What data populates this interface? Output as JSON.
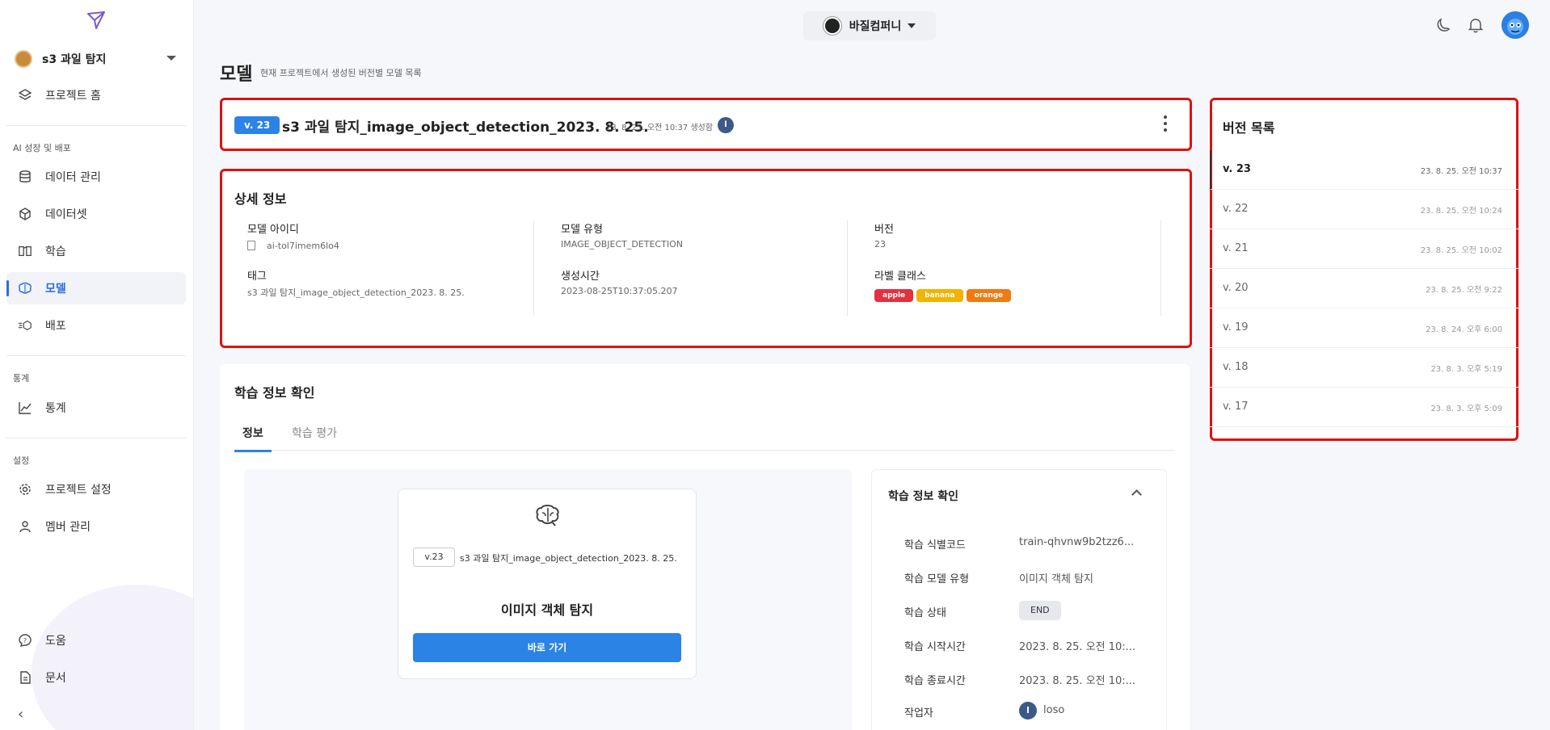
{
  "sidebar": {
    "project_name": "s3 과일 탐지",
    "items": [
      {
        "label": "프로젝트 홈"
      },
      {
        "label": "데이터 관리"
      },
      {
        "label": "데이터셋"
      },
      {
        "label": "학습"
      },
      {
        "label": "모델"
      },
      {
        "label": "배포"
      },
      {
        "label": "통계"
      },
      {
        "label": "프로젝트 설정"
      },
      {
        "label": "멤버 관리"
      },
      {
        "label": "도움"
      },
      {
        "label": "문서"
      }
    ],
    "sections": [
      "AI 성장 및 배포",
      "통계",
      "설정"
    ],
    "collapse_label": "‹"
  },
  "topbar": {
    "company": "바질컴퍼니"
  },
  "page": {
    "title": "모델",
    "subtitle": "현재 프로젝트에서 생성된 버전별 모델 목록"
  },
  "model_header": {
    "version_badge": "v. 23",
    "title": "s3 과일 탐지_image_object_detection_2023. 8. 25.",
    "meta": "23. 8. 25. 오전 10:37 생성함",
    "creator_initial": "l"
  },
  "detail": {
    "title": "상세 정보",
    "model_id_label": "모델 아이디",
    "model_id": "ai-tol7imem6lo4",
    "tag_label": "태그",
    "tag": "s3 과일 탐지_image_object_detection_2023. 8. 25.",
    "model_type_label": "모델 유형",
    "model_type": "IMAGE_OBJECT_DETECTION",
    "created_label": "생성시간",
    "created": "2023-08-25T10:37:05.207",
    "version_label": "버전",
    "version": "23",
    "classes_label": "라벨 클래스",
    "classes": [
      {
        "name": "apple",
        "color": "#e5303f"
      },
      {
        "name": "banana",
        "color": "#f2b400"
      },
      {
        "name": "orange",
        "color": "#f07b12"
      }
    ]
  },
  "training": {
    "title": "학습 정보 확인",
    "tabs": [
      {
        "label": "정보"
      },
      {
        "label": "학습 평가"
      }
    ],
    "card": {
      "version_tag": "v.23",
      "model_title": "s3 과일 탐지_image_object_detection_2023. 8. 25.",
      "type": "이미지 객체 탐지",
      "button": "바로 가기"
    },
    "info": {
      "title": "학습 정보 확인",
      "rows": [
        {
          "k": "학습 식별코드",
          "v": "train-qhvnw9b2tzz6..."
        },
        {
          "k": "학습 모델 유형",
          "v": "이미지 객체 탐지"
        },
        {
          "k": "학습 상태",
          "v": "END"
        },
        {
          "k": "학습 시작시간",
          "v": "2023. 8. 25. 오전 10:..."
        },
        {
          "k": "학습 종료시간",
          "v": "2023. 8. 25. 오전 10:..."
        },
        {
          "k": "작업자",
          "v": "loso"
        }
      ],
      "worker_initial": "l"
    }
  },
  "versions": {
    "title": "버전 목록",
    "items": [
      {
        "label": "v. 23",
        "time": "23. 8. 25. 오전 10:37"
      },
      {
        "label": "v. 22",
        "time": "23. 8. 25. 오전 10:24"
      },
      {
        "label": "v. 21",
        "time": "23. 8. 25. 오전 10:02"
      },
      {
        "label": "v. 20",
        "time": "23. 8. 25. 오전 9:22"
      },
      {
        "label": "v. 19",
        "time": "23. 8. 24. 오후 6:00"
      },
      {
        "label": "v. 18",
        "time": "23. 8. 3. 오후 5:19"
      },
      {
        "label": "v. 17",
        "time": "23. 8. 3. 오후 5:09"
      }
    ]
  },
  "colors": {
    "accent": "#2b83e6",
    "highlight_box": "#e01010"
  }
}
